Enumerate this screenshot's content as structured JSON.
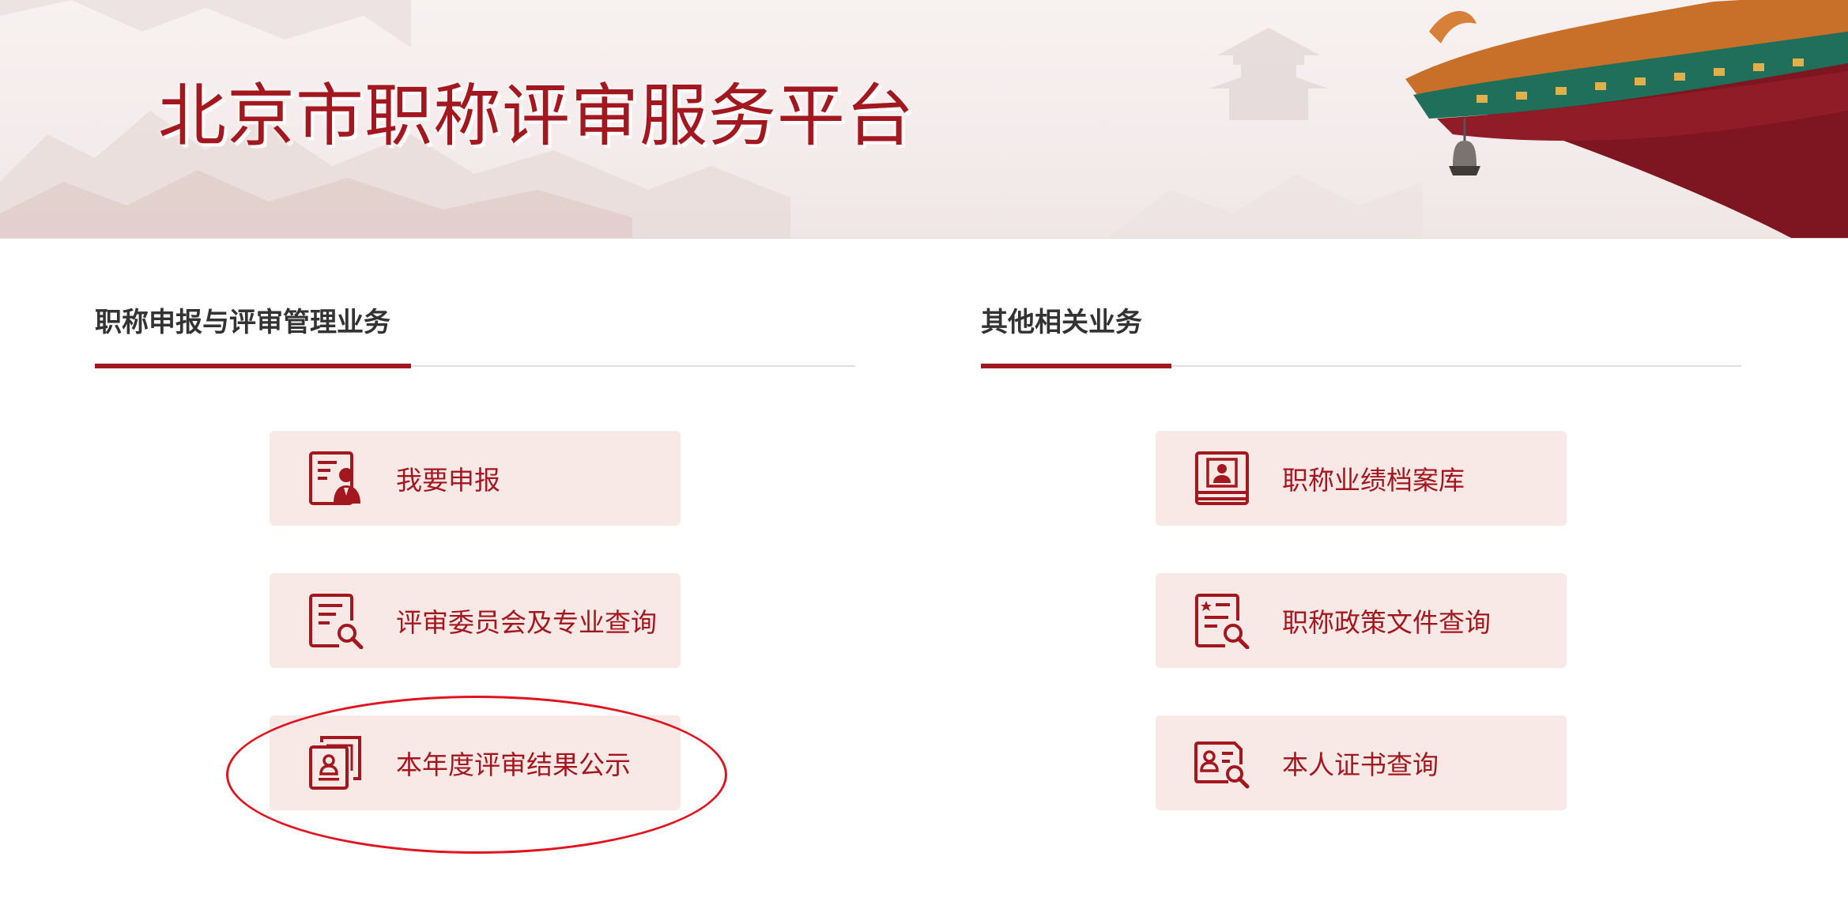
{
  "banner": {
    "title": "北京市职称评审服务平台"
  },
  "left_section": {
    "title": "职称申报与评审管理业务",
    "buttons": [
      {
        "label": "我要申报",
        "icon": "applicant-form-icon"
      },
      {
        "label": "评审委员会及专业查询",
        "icon": "document-search-icon"
      },
      {
        "label": "本年度评审结果公示",
        "icon": "result-publicity-icon"
      }
    ]
  },
  "right_section": {
    "title": "其他相关业务",
    "buttons": [
      {
        "label": "职称业绩档案库",
        "icon": "profile-archive-icon"
      },
      {
        "label": "职称政策文件查询",
        "icon": "policy-search-icon"
      },
      {
        "label": "本人证书查询",
        "icon": "certificate-search-icon"
      }
    ]
  },
  "colors": {
    "brand_red": "#a3171f",
    "button_bg": "#f8e9e6",
    "annotation_red": "#e0141e"
  }
}
